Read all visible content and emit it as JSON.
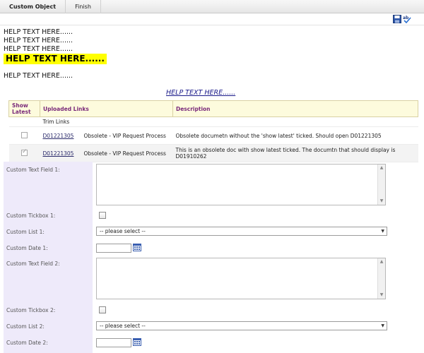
{
  "tabs": [
    {
      "label": "Custom Object"
    },
    {
      "label": "Finish"
    }
  ],
  "help_texts": [
    "HELP TEXT HERE......",
    "HELP TEXT HERE......",
    "HELP TEXT HERE......"
  ],
  "help_highlight": "HELP TEXT HERE......",
  "help_text_4": "HELP TEXT HERE......",
  "help_link": "HELP TEXT HERE......",
  "links_table": {
    "headers": {
      "show_latest": "Show Latest",
      "uploaded_links": "Uploaded Links",
      "description": "Description"
    },
    "trim_links_label": "Trim Links",
    "rows": [
      {
        "checked": false,
        "doc": "D01221305",
        "title": "Obsolete - VIP Request Process",
        "description": "Obsolete documetn without the 'show latest' ticked. Should open D01221305"
      },
      {
        "checked": true,
        "doc": "D01221305",
        "title": "Obsolete - VIP Request Process",
        "description": "This is an obsolete doc with show latest ticked. The documtn that should display is D01910262"
      }
    ]
  },
  "form": {
    "text_field_1_label": "Custom Text Field 1:",
    "tickbox_1_label": "Custom Tickbox 1:",
    "list_1_label": "Custom List 1:",
    "list_1_value": "-- please select --",
    "date_1_label": "Custom Date 1:",
    "text_field_2_label": "Custom Text Field 2:",
    "tickbox_2_label": "Custom Tickbox 2:",
    "list_2_label": "Custom List 2:",
    "list_2_value": "-- please select --",
    "date_2_label": "Custom Date 2:"
  }
}
